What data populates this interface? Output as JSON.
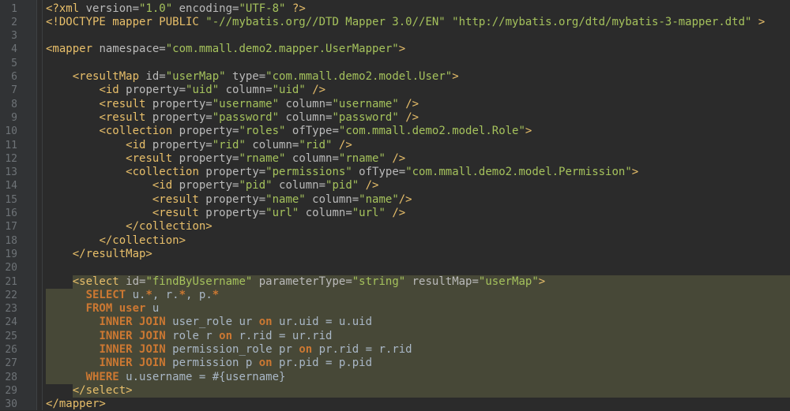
{
  "editor": {
    "language": "xml-mybatis-mapper",
    "theme_colors": {
      "background": "#2b2b2b",
      "gutter": "#313335",
      "tag": "#e8bf6a",
      "attribute": "#bababa",
      "string": "#a5c25c",
      "keyword": "#cc7832",
      "text": "#a9b7c6",
      "highlight": "#474837"
    },
    "highlighted_lines": [
      21,
      29
    ],
    "lines": [
      {
        "n": "1",
        "tokens": [
          [
            "tag",
            "<?xml "
          ],
          [
            "attr",
            "version="
          ],
          [
            "str",
            "\"1.0\""
          ],
          [
            "attr",
            " encoding="
          ],
          [
            "str",
            "\"UTF-8\""
          ],
          [
            "tag",
            " ?>"
          ]
        ]
      },
      {
        "n": "2",
        "tokens": [
          [
            "tag",
            "<!DOCTYPE mapper PUBLIC "
          ],
          [
            "str",
            "\"-//mybatis.org//DTD Mapper 3.0//EN\""
          ],
          [
            "tag",
            " "
          ],
          [
            "str",
            "\"http://mybatis.org/dtd/mybatis-3-mapper.dtd\""
          ],
          [
            "tag",
            " >"
          ]
        ]
      },
      {
        "n": "3",
        "tokens": []
      },
      {
        "n": "4",
        "tokens": [
          [
            "tag",
            "<mapper "
          ],
          [
            "attr",
            "namespace="
          ],
          [
            "str",
            "\"com.mmall.demo2.mapper.UserMapper\""
          ],
          [
            "tag",
            ">"
          ]
        ]
      },
      {
        "n": "5",
        "tokens": []
      },
      {
        "n": "6",
        "tokens": [
          [
            "plain",
            "    "
          ],
          [
            "tag",
            "<resultMap "
          ],
          [
            "attr",
            "id="
          ],
          [
            "str",
            "\"userMap\""
          ],
          [
            "attr",
            " type="
          ],
          [
            "str",
            "\"com.mmall.demo2.model.User\""
          ],
          [
            "tag",
            ">"
          ]
        ]
      },
      {
        "n": "7",
        "tokens": [
          [
            "plain",
            "        "
          ],
          [
            "tag",
            "<id "
          ],
          [
            "attr",
            "property="
          ],
          [
            "str",
            "\"uid\""
          ],
          [
            "attr",
            " column="
          ],
          [
            "str",
            "\"uid\""
          ],
          [
            "tag",
            " />"
          ]
        ]
      },
      {
        "n": "8",
        "tokens": [
          [
            "plain",
            "        "
          ],
          [
            "tag",
            "<result "
          ],
          [
            "attr",
            "property="
          ],
          [
            "str",
            "\"username\""
          ],
          [
            "attr",
            " column="
          ],
          [
            "str",
            "\"username\""
          ],
          [
            "tag",
            " />"
          ]
        ]
      },
      {
        "n": "9",
        "tokens": [
          [
            "plain",
            "        "
          ],
          [
            "tag",
            "<result "
          ],
          [
            "attr",
            "property="
          ],
          [
            "str",
            "\"password\""
          ],
          [
            "attr",
            " column="
          ],
          [
            "str",
            "\"password\""
          ],
          [
            "tag",
            " />"
          ]
        ]
      },
      {
        "n": "10",
        "tokens": [
          [
            "plain",
            "        "
          ],
          [
            "tag",
            "<collection "
          ],
          [
            "attr",
            "property="
          ],
          [
            "str",
            "\"roles\""
          ],
          [
            "attr",
            " ofType="
          ],
          [
            "str",
            "\"com.mmall.demo2.model.Role\""
          ],
          [
            "tag",
            ">"
          ]
        ]
      },
      {
        "n": "11",
        "tokens": [
          [
            "plain",
            "            "
          ],
          [
            "tag",
            "<id "
          ],
          [
            "attr",
            "property="
          ],
          [
            "str",
            "\"rid\""
          ],
          [
            "attr",
            " column="
          ],
          [
            "str",
            "\"rid\""
          ],
          [
            "tag",
            " />"
          ]
        ]
      },
      {
        "n": "12",
        "tokens": [
          [
            "plain",
            "            "
          ],
          [
            "tag",
            "<result "
          ],
          [
            "attr",
            "property="
          ],
          [
            "str",
            "\"rname\""
          ],
          [
            "attr",
            " column="
          ],
          [
            "str",
            "\"rname\""
          ],
          [
            "tag",
            " />"
          ]
        ]
      },
      {
        "n": "13",
        "tokens": [
          [
            "plain",
            "            "
          ],
          [
            "tag",
            "<collection "
          ],
          [
            "attr",
            "property="
          ],
          [
            "str",
            "\"permissions\""
          ],
          [
            "attr",
            " ofType="
          ],
          [
            "str",
            "\"com.mmall.demo2.model.Permission\""
          ],
          [
            "tag",
            ">"
          ]
        ]
      },
      {
        "n": "14",
        "tokens": [
          [
            "plain",
            "                "
          ],
          [
            "tag",
            "<id "
          ],
          [
            "attr",
            "property="
          ],
          [
            "str",
            "\"pid\""
          ],
          [
            "attr",
            " column="
          ],
          [
            "str",
            "\"pid\""
          ],
          [
            "tag",
            " />"
          ]
        ]
      },
      {
        "n": "15",
        "tokens": [
          [
            "plain",
            "                "
          ],
          [
            "tag",
            "<result "
          ],
          [
            "attr",
            "property="
          ],
          [
            "str",
            "\"name\""
          ],
          [
            "attr",
            " column="
          ],
          [
            "str",
            "\"name\""
          ],
          [
            "tag",
            "/>"
          ]
        ]
      },
      {
        "n": "16",
        "tokens": [
          [
            "plain",
            "                "
          ],
          [
            "tag",
            "<result "
          ],
          [
            "attr",
            "property="
          ],
          [
            "str",
            "\"url\""
          ],
          [
            "attr",
            " column="
          ],
          [
            "str",
            "\"url\""
          ],
          [
            "tag",
            " />"
          ]
        ]
      },
      {
        "n": "17",
        "tokens": [
          [
            "plain",
            "            "
          ],
          [
            "tag",
            "</collection>"
          ]
        ]
      },
      {
        "n": "18",
        "tokens": [
          [
            "plain",
            "        "
          ],
          [
            "tag",
            "</collection>"
          ]
        ]
      },
      {
        "n": "19",
        "tokens": [
          [
            "plain",
            "    "
          ],
          [
            "tag",
            "</resultMap>"
          ]
        ]
      },
      {
        "n": "20",
        "tokens": []
      },
      {
        "n": "21",
        "tokens": [
          [
            "plain",
            "    "
          ],
          [
            "tag",
            "<select "
          ],
          [
            "attr",
            "id="
          ],
          [
            "str",
            "\"findByUsername\""
          ],
          [
            "attr",
            " parameterType="
          ],
          [
            "str",
            "\"string\""
          ],
          [
            "attr",
            " resultMap="
          ],
          [
            "str",
            "\"userMap\""
          ],
          [
            "tag",
            ">"
          ]
        ]
      },
      {
        "n": "22",
        "tokens": [
          [
            "plain",
            "      "
          ],
          [
            "kw",
            "SELECT"
          ],
          [
            "plain",
            " u."
          ],
          [
            "kw",
            "*"
          ],
          [
            "plain",
            ", r."
          ],
          [
            "kw",
            "*"
          ],
          [
            "plain",
            ", p."
          ],
          [
            "kw",
            "*"
          ]
        ]
      },
      {
        "n": "23",
        "tokens": [
          [
            "plain",
            "      "
          ],
          [
            "kw",
            "FROM"
          ],
          [
            "plain",
            " "
          ],
          [
            "kw",
            "user"
          ],
          [
            "plain",
            " u"
          ]
        ]
      },
      {
        "n": "24",
        "tokens": [
          [
            "plain",
            "        "
          ],
          [
            "kw",
            "INNER JOIN"
          ],
          [
            "plain",
            " user_role ur "
          ],
          [
            "kw",
            "on"
          ],
          [
            "plain",
            " ur.uid = u.uid"
          ]
        ]
      },
      {
        "n": "25",
        "tokens": [
          [
            "plain",
            "        "
          ],
          [
            "kw",
            "INNER JOIN"
          ],
          [
            "plain",
            " role r "
          ],
          [
            "kw",
            "on"
          ],
          [
            "plain",
            " r.rid = ur.rid"
          ]
        ]
      },
      {
        "n": "26",
        "tokens": [
          [
            "plain",
            "        "
          ],
          [
            "kw",
            "INNER JOIN"
          ],
          [
            "plain",
            " permission_role pr "
          ],
          [
            "kw",
            "on"
          ],
          [
            "plain",
            " pr.rid = r.rid"
          ]
        ]
      },
      {
        "n": "27",
        "tokens": [
          [
            "plain",
            "        "
          ],
          [
            "kw",
            "INNER JOIN"
          ],
          [
            "plain",
            " permission p "
          ],
          [
            "kw",
            "on"
          ],
          [
            "plain",
            " pr.pid = p.pid"
          ]
        ]
      },
      {
        "n": "28",
        "tokens": [
          [
            "plain",
            "      "
          ],
          [
            "kw",
            "WHERE"
          ],
          [
            "plain",
            " u.username = #{username}"
          ]
        ]
      },
      {
        "n": "29",
        "tokens": [
          [
            "plain",
            "    "
          ],
          [
            "tag",
            "</select>"
          ]
        ]
      },
      {
        "n": "30",
        "tokens": [
          [
            "tag",
            "</mapper>"
          ]
        ]
      }
    ]
  }
}
